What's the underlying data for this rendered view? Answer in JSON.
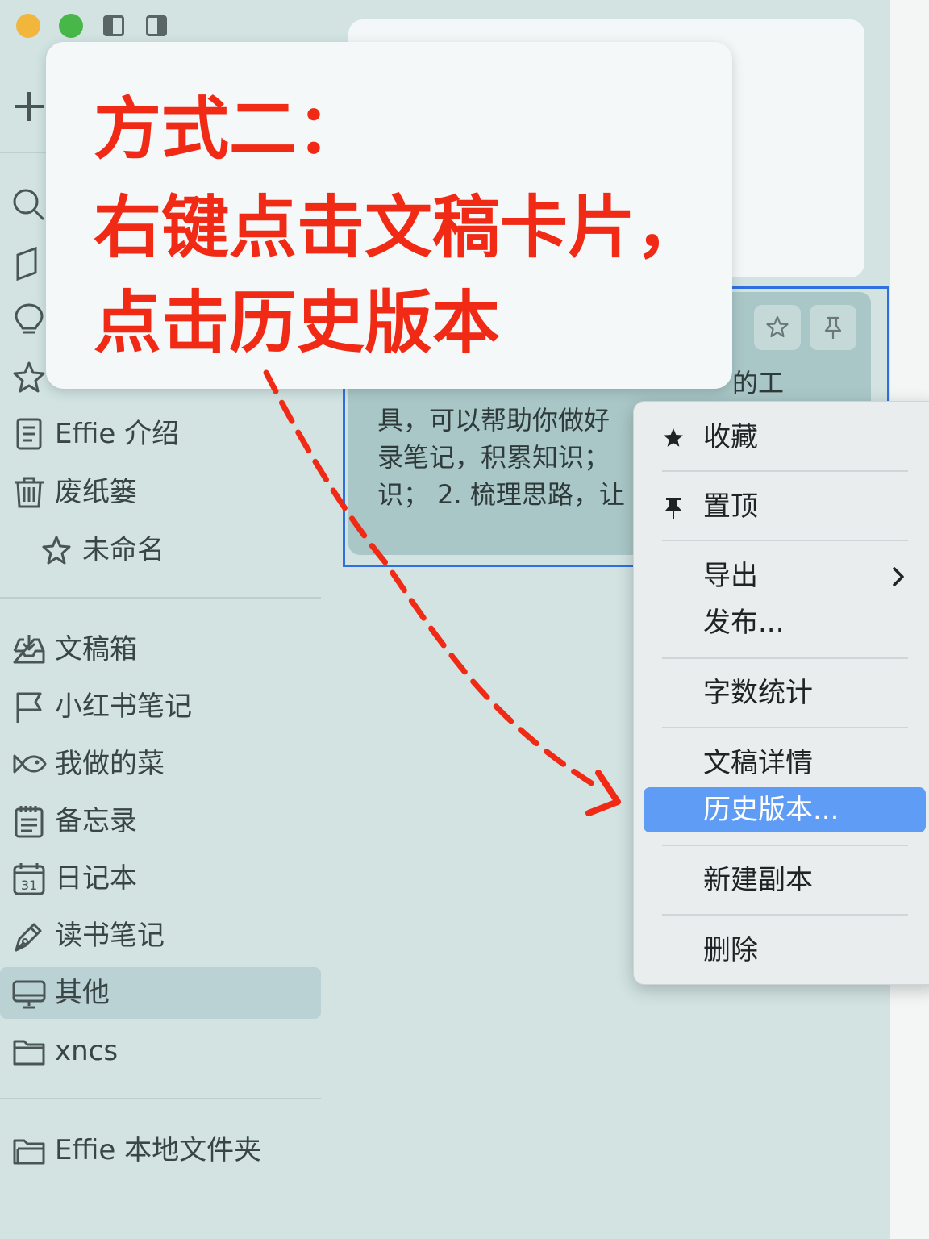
{
  "callout": {
    "line1": "方式二：",
    "line2": "右键点击文稿卡片，",
    "line3": "点击历史版本"
  },
  "sidebar": {
    "items": [
      {
        "label": "Effie 介绍",
        "icon": "document-icon"
      },
      {
        "label": "废纸篓",
        "icon": "trash-icon"
      },
      {
        "label": "未命名",
        "icon": "star-outline-icon"
      },
      {
        "label": "文稿箱",
        "icon": "inbox-icon"
      },
      {
        "label": "小红书笔记",
        "icon": "flag-icon"
      },
      {
        "label": "我做的菜",
        "icon": "fish-icon"
      },
      {
        "label": "备忘录",
        "icon": "notepad-icon"
      },
      {
        "label": "日记本",
        "icon": "calendar-icon"
      },
      {
        "label": "读书笔记",
        "icon": "pen-nib-icon"
      },
      {
        "label": "其他",
        "icon": "monitor-icon"
      },
      {
        "label": "xncs",
        "icon": "folder-icon"
      },
      {
        "label": "Effie 本地文件夹",
        "icon": "folder-icon"
      }
    ],
    "calendar_day": "31"
  },
  "card": {
    "lines": [
      "的工",
      "具，可以帮助你做好",
      "录笔记，积累知识；",
      "识； 2. 梳理思路，让"
    ]
  },
  "context_menu": {
    "favorite": "收藏",
    "pin": "置顶",
    "export": "导出",
    "publish": "发布...",
    "word_count": "字数统计",
    "doc_details": "文稿详情",
    "history": "历史版本...",
    "duplicate": "新建副本",
    "delete": "删除"
  },
  "colors": {
    "sidebar_bg": "#d2e3e2",
    "callout_text": "#f02a14",
    "menu_highlight": "#5e9cf6",
    "selection_border": "#2f6fe0"
  }
}
